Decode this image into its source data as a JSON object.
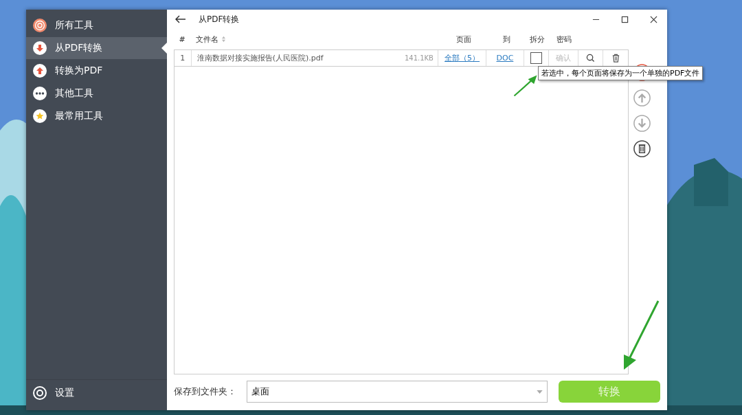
{
  "sidebar": {
    "items": [
      {
        "label": "所有工具",
        "kind": "spiral",
        "selected": false
      },
      {
        "label": "从PDF转换",
        "kind": "down",
        "selected": true
      },
      {
        "label": "转换为PDF",
        "kind": "up",
        "selected": false
      },
      {
        "label": "其他工具",
        "kind": "dots",
        "selected": false
      },
      {
        "label": "最常用工具",
        "kind": "star",
        "selected": false
      }
    ],
    "settings": "设置"
  },
  "window": {
    "title": "从PDF转换"
  },
  "table": {
    "columns": [
      "#",
      "文件名",
      "页面",
      "到",
      "拆分",
      "密码"
    ],
    "rows": [
      {
        "index": "1",
        "name": "淮南数据对接实施报告(人民医院).pdf",
        "size": "141.1KB",
        "pages": "全部（5）",
        "format": "DOC",
        "split": false,
        "password": "确认"
      }
    ]
  },
  "tooltip": "若选中，每个页面将保存为一个单独的PDF文件",
  "save": {
    "label": "保存到文件夹：",
    "value": "桌面"
  },
  "convert_button": "转换"
}
